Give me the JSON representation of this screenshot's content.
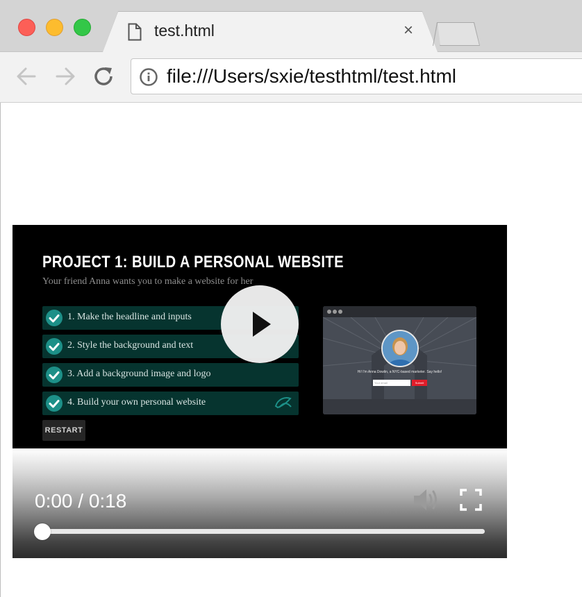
{
  "browser": {
    "tab_title": "test.html",
    "tab_close": "×",
    "url": "file:///Users/sxie/testhtml/test.html"
  },
  "video": {
    "project_title": "PROJECT 1: BUILD A PERSONAL WEBSITE",
    "project_subtitle": "Your friend Anna wants you to make a website for her",
    "steps": [
      {
        "label": "1. Make the headline and inputs"
      },
      {
        "label": "2. Style the background and text"
      },
      {
        "label": "3. Add a background image and logo"
      },
      {
        "label": "4. Build your own personal website"
      }
    ],
    "restart_label": "RESTART",
    "preview": {
      "text": "Hi! I'm Anna Dowlin, a NYC-based marketer. Say hello!",
      "input_placeholder": "Your email",
      "submit_label": "Submit"
    },
    "controls": {
      "time": "0:00 / 0:18",
      "progress": 0
    }
  },
  "colors": {
    "step_bg": "#06342f",
    "check": "#1d9088",
    "submit": "#e11d2a"
  }
}
